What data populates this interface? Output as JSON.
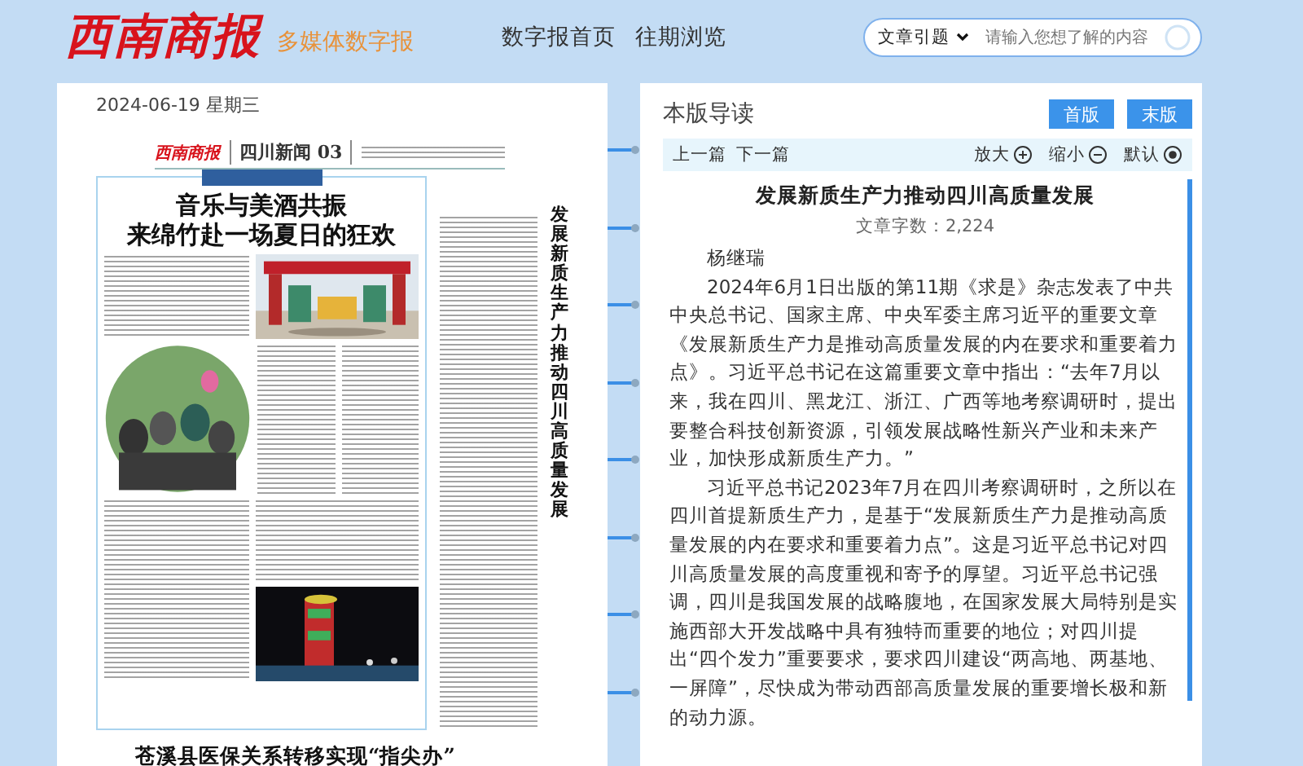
{
  "header": {
    "logo": "西南商报",
    "subtitle": "多媒体数字报",
    "nav": [
      {
        "label": "数字报首页"
      },
      {
        "label": "往期浏览"
      }
    ],
    "search": {
      "scope": "文章引题",
      "placeholder": "请输入您想了解的内容"
    }
  },
  "page": {
    "date": "2024-06-19 星期三",
    "masthead": {
      "logo": "西南商报",
      "section": "四川新闻 03"
    },
    "feature": {
      "headline_1": "音乐与美酒共振",
      "headline_2": "来绵竹赴一场夏日的狂欢"
    },
    "side_title": "发展新质生产力推动四川高质量发展",
    "bottom_headline": "苍溪县医保关系转移实现“指尖办”"
  },
  "reader": {
    "title": "本版导读",
    "buttons": [
      {
        "label": "首版"
      },
      {
        "label": "末版"
      }
    ],
    "nav": [
      {
        "label": "上一篇"
      },
      {
        "label": "下一篇"
      }
    ],
    "zoom": [
      {
        "label": "放大",
        "kind": "plus"
      },
      {
        "label": "缩小",
        "kind": "minus"
      },
      {
        "label": "默认",
        "kind": "dot"
      }
    ],
    "article": {
      "title": "发展新质生产力推动四川高质量发展",
      "word_count": "文章字数：2,224",
      "author": "杨继瑞",
      "paragraphs": [
        "2024年6月1日出版的第11期《求是》杂志发表了中共中央总书记、国家主席、中央军委主席习近平的重要文章《发展新质生产力是推动高质量发展的内在要求和重要着力点》。习近平总书记在这篇重要文章中指出：“去年7月以来，我在四川、黑龙江、浙江、广西等地考察调研时，提出要整合科技创新资源，引领发展战略性新兴产业和未来产业，加快形成新质生产力。”",
        "习近平总书记2023年7月在四川考察调研时，之所以在四川首提新质生产力，是基于“发展新质生产力是推动高质量发展的内在要求和重要着力点”。这是习近平总书记对四川高质量发展的高度重视和寄予的厚望。习近平总书记强调，四川是我国发展的战略腹地，在国家发展大局特别是实施西部大开发战略中具有独特而重要的地位；对四川提出“四个发力”重要要求，要求四川建设“两高地、两基地、一屏障”，尽快成为带动西部高质量发展的重要增长极和新的动力源。"
      ]
    }
  }
}
